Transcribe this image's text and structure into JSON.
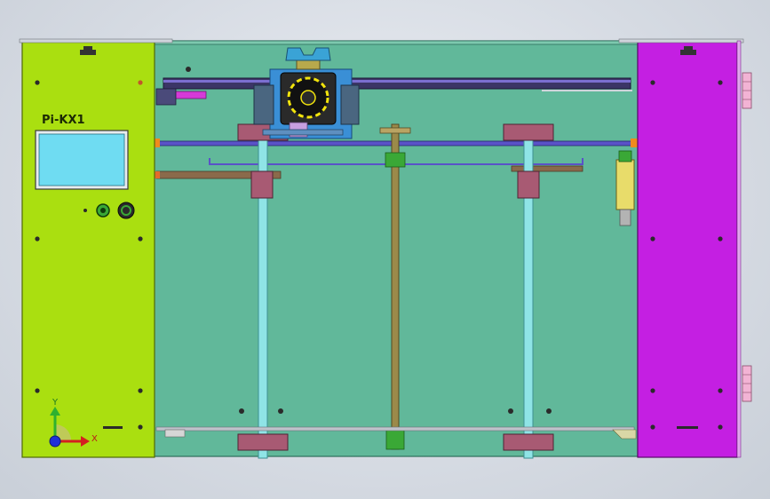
{
  "model_label": "Pi-KX1",
  "axis_triad": {
    "y_label": "Y",
    "x_label": "X"
  },
  "colors": {
    "viewport_bg": "#d9dde5",
    "left_panel": "#aadf10",
    "right_panel": "#c41fe2",
    "frame_interior": "#61b89a",
    "lcd_screen": "#6fdcf2",
    "fan_body": "#2a2a2a",
    "fan_blades": "#f2e40c",
    "lead_screw": "#9b8a4a",
    "guide_rod": "#8fe4e6",
    "bearing_block": "#a85a73",
    "x_rail": "#5a52c8",
    "coupler": "#3aa836",
    "hinge": "#f2b3d4"
  }
}
